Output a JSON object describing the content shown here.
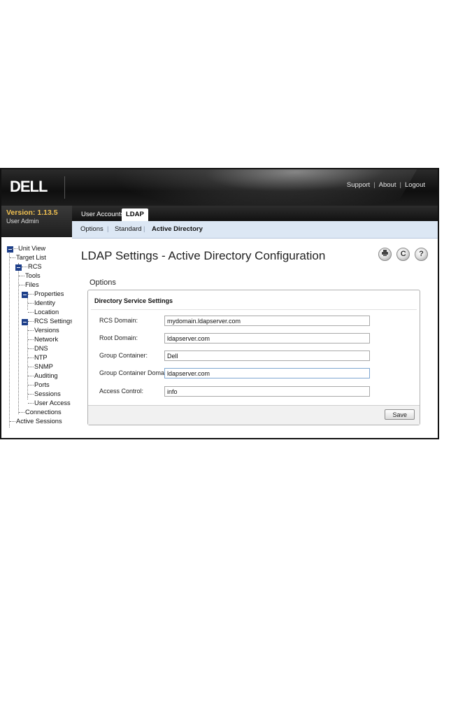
{
  "header": {
    "logo": "DELL",
    "links": [
      "Support",
      "About",
      "Logout"
    ]
  },
  "sidebar": {
    "version": "Version: 1.13.5",
    "role": "User Admin",
    "tree": [
      {
        "label": "Unit View"
      },
      {
        "label": "Target List"
      },
      {
        "label": "RCS"
      },
      {
        "label": "Tools"
      },
      {
        "label": "Files"
      },
      {
        "label": "Properties"
      },
      {
        "label": "Identity"
      },
      {
        "label": "Location"
      },
      {
        "label": "RCS Settings"
      },
      {
        "label": "Versions"
      },
      {
        "label": "Network"
      },
      {
        "label": "DNS"
      },
      {
        "label": "NTP"
      },
      {
        "label": "SNMP"
      },
      {
        "label": "Auditing"
      },
      {
        "label": "Ports"
      },
      {
        "label": "Sessions"
      },
      {
        "label": "User Access"
      },
      {
        "label": "Connections"
      },
      {
        "label": "Active Sessions"
      }
    ]
  },
  "tabs": [
    {
      "label": "User Accounts"
    },
    {
      "label": "LDAP"
    }
  ],
  "subnav": [
    {
      "label": "Options"
    },
    {
      "label": "Standard"
    },
    {
      "label": "Active Directory"
    }
  ],
  "page": {
    "title": "LDAP Settings - Active Directory Configuration",
    "section": "Options",
    "fieldset_title": "Directory Service Settings",
    "fields": [
      {
        "label": "RCS Domain:",
        "value": "mydomain.ldapserver.com"
      },
      {
        "label": "Root Domain:",
        "value": "ldapserver.com"
      },
      {
        "label": "Group Container:",
        "value": "Dell"
      },
      {
        "label": "Group Container Domain:",
        "value": "ldapserver.com"
      },
      {
        "label": "Access Control:",
        "value": "info"
      }
    ],
    "save_label": "Save"
  },
  "icons": [
    "print-icon",
    "refresh-icon",
    "help-icon"
  ]
}
